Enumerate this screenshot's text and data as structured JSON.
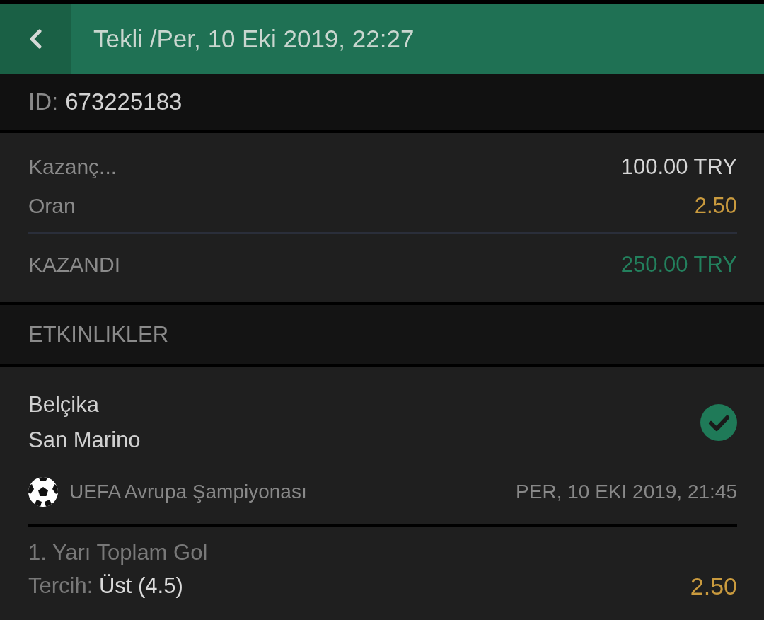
{
  "header": {
    "title": "Tekli /Per, 10 Eki 2019, 22:27"
  },
  "id_row": {
    "label": "ID:",
    "value": "673225183"
  },
  "summary": {
    "rows": [
      {
        "label": "Kazanç...",
        "value": "100.00 TRY",
        "kind": "stake"
      },
      {
        "label": "Oran",
        "value": "2.50",
        "kind": "odds"
      }
    ],
    "result": {
      "label": "KAZANDI",
      "value": "250.00 TRY",
      "kind": "won"
    }
  },
  "events_heading": "ETKINLIKLER",
  "events": [
    {
      "teams": [
        "Belçika",
        "San Marino"
      ],
      "won": true,
      "sport_icon": {
        "kind": "football"
      },
      "league": "UEFA Avrupa Şampiyonası",
      "date": "PER, 10 EKI 2019, 21:45",
      "market": "1. Yarı Toplam Gol",
      "pick_label": "Tercih:",
      "pick": "Üst (4.5)",
      "odds": "2.50"
    }
  ]
}
